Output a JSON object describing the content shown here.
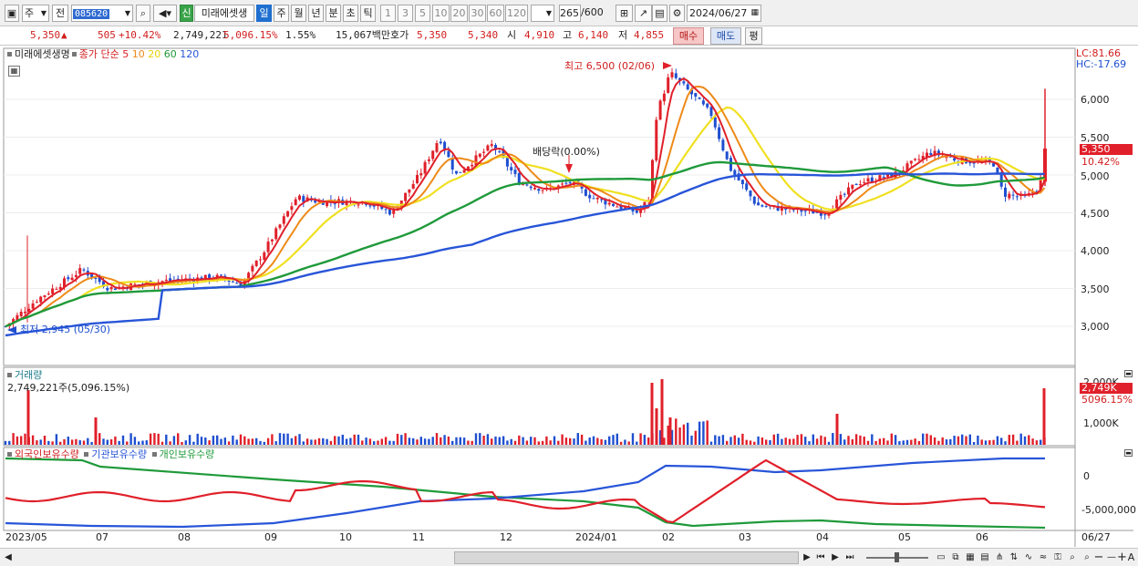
{
  "toolbar": {
    "type1": "주",
    "type2": "전",
    "code": "085620",
    "new_badge": "신",
    "stock_name": "미래에셋생",
    "periods": [
      "일",
      "주",
      "월",
      "년",
      "분",
      "초",
      "틱"
    ],
    "selected_period": "일",
    "intervals": [
      "1",
      "3",
      "5",
      "10",
      "20",
      "30",
      "60",
      "120"
    ],
    "count_value": "265",
    "count_max": "/600",
    "date": "2024/06/27"
  },
  "quote": {
    "price": "5,350",
    "change": "505",
    "change_pct": "+10.42%",
    "volume": "2,749,221",
    "volume_ratio": "5,096.15%",
    "turnover": "1.55%",
    "amount": "15,067백만",
    "bid_label": "호가",
    "bid1": "5,350",
    "bid2": "5,340",
    "open_label": "시",
    "open": "4,910",
    "high_label": "고",
    "high": "6,140",
    "low_label": "저",
    "low": "4,855",
    "buy": "매수",
    "sell": "매도",
    "avg": "평"
  },
  "legend": {
    "name": "미래에셋생명",
    "ma_title": "종가 단순",
    "ma": [
      {
        "label": "5",
        "color": "#e0202a"
      },
      {
        "label": "10",
        "color": "#ee8a18"
      },
      {
        "label": "20",
        "color": "#f0e020"
      },
      {
        "label": "60",
        "color": "#1f9a3a"
      },
      {
        "label": "120",
        "color": "#2855d8"
      }
    ],
    "lc": "LC:81.66",
    "hc": "HC:-17.69"
  },
  "annotations": {
    "high_note": "최고 6,500 (02/06)",
    "low_note": "최저 2,945 (05/30)",
    "dividend_note": "배당락(0.00%)"
  },
  "price_axis": {
    "ticks": [
      "6,000",
      "5,500",
      "5,000",
      "4,500",
      "4,000",
      "3,500",
      "3,000"
    ],
    "current_tag": "5,350",
    "current_pct": "10.42%"
  },
  "volume_panel": {
    "title": "거래량",
    "summary": "2,749,221주(5,096.15%)",
    "ticks": [
      "2,000K",
      "1,000K"
    ],
    "current_tag": "2,749K",
    "current_pct": "5096.15%"
  },
  "holdings_panel": {
    "legend": [
      {
        "label": "외국인보유수량",
        "color": "#d21e1e"
      },
      {
        "label": "기관보유수량",
        "color": "#2855d8"
      },
      {
        "label": "개인보유수량",
        "color": "#1f9a3a"
      }
    ],
    "ticks": [
      "0",
      "-5,000,000"
    ]
  },
  "x_axis": {
    "labels": [
      "2023/05",
      "07",
      "08",
      "09",
      "10",
      "11",
      "12",
      "2024/01",
      "02",
      "03",
      "04",
      "05",
      "06"
    ],
    "right_label": "06/27"
  },
  "colors": {
    "up": "#e0202a",
    "down": "#1f4fd0",
    "ma5": "#e0202a",
    "ma10": "#ee8a18",
    "ma20": "#f0e020",
    "ma60": "#1f9a3a",
    "ma120": "#2855d8"
  }
}
